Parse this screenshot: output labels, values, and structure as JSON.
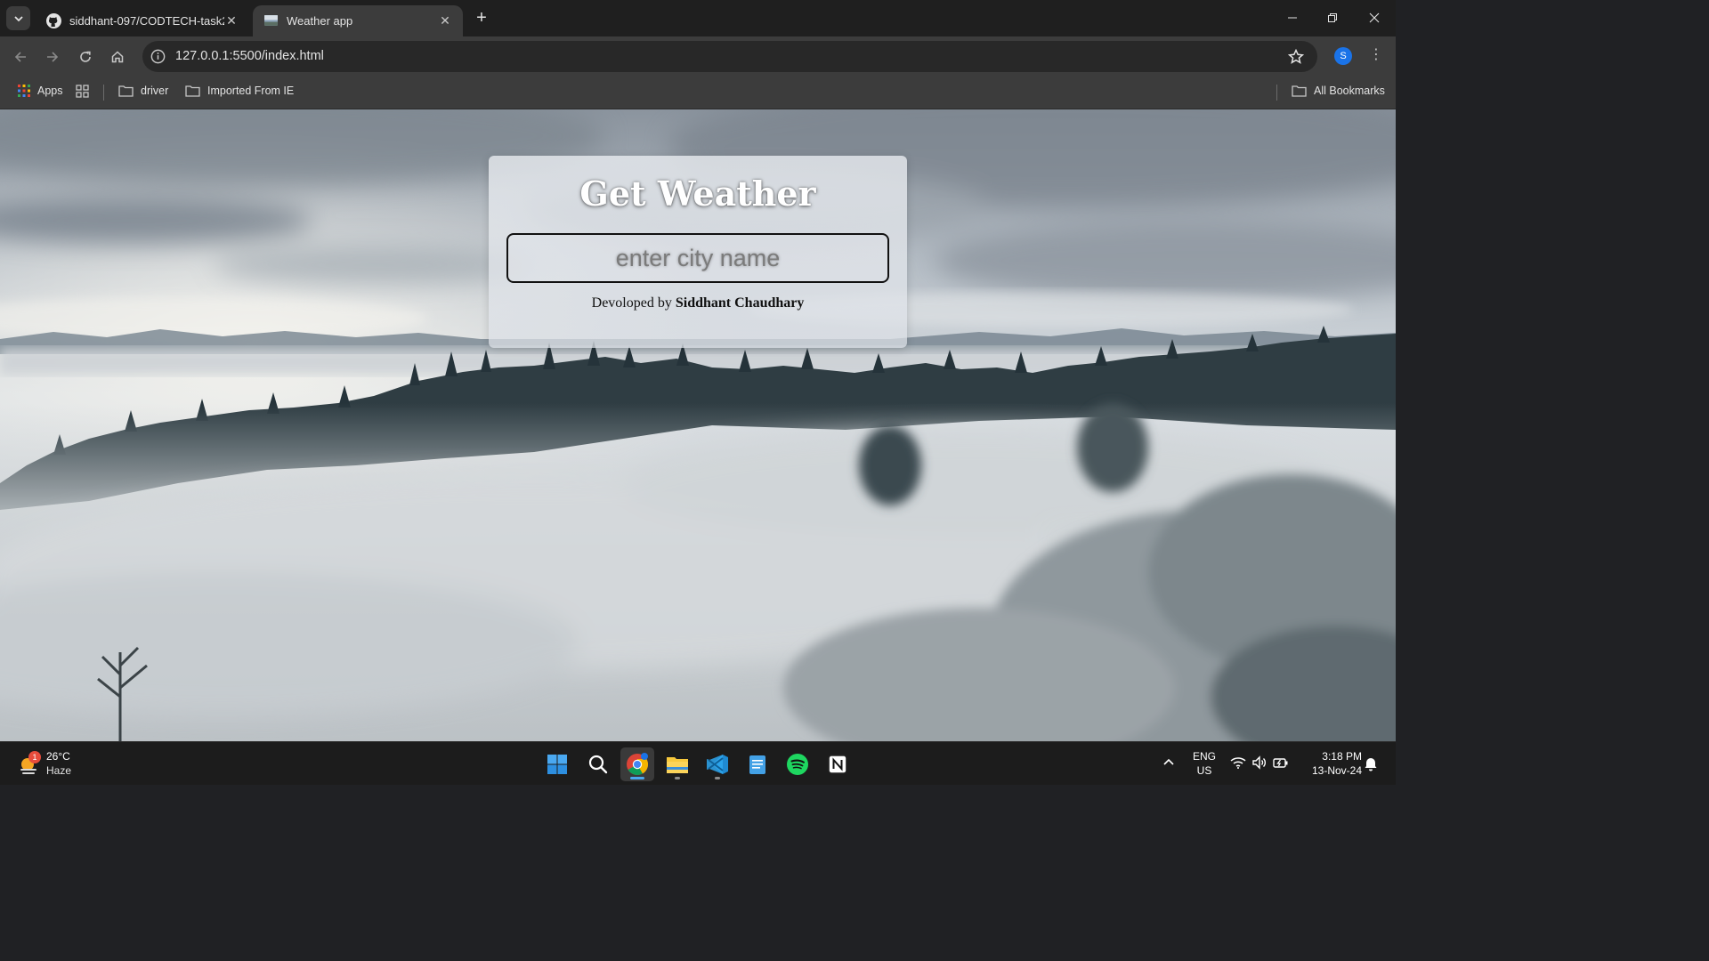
{
  "browser": {
    "tabs": [
      {
        "title": "siddhant-097/CODTECH-task2",
        "active": false,
        "icon": "github-icon"
      },
      {
        "title": "Weather app",
        "active": true,
        "icon": "weather-favicon-icon"
      }
    ],
    "url": "127.0.0.1:5500/index.html",
    "profile_initial": "S",
    "bookmarks": [
      {
        "label": "Apps",
        "icon": "apps-grid-icon"
      },
      {
        "label": "driver",
        "icon": "folder-icon"
      },
      {
        "label": "Imported From IE",
        "icon": "folder-icon"
      }
    ],
    "all_bookmarks_label": "All Bookmarks"
  },
  "page": {
    "title": "Get Weather",
    "input_placeholder": "enter city name",
    "credit_prefix": "Devoloped by",
    "credit_name": "Siddhant Chaudhary"
  },
  "taskbar": {
    "weather_temp": "26°C",
    "weather_desc": "Haze",
    "weather_badge": "1",
    "lang_primary": "ENG",
    "lang_secondary": "US",
    "time": "3:18 PM",
    "date": "13-Nov-24",
    "apps": [
      "start-icon",
      "search-icon",
      "chrome-icon",
      "file-explorer-icon",
      "vscode-icon",
      "notepad-icon",
      "spotify-icon",
      "notion-icon"
    ]
  },
  "colors": {
    "tabstrip": "#1f1f1f",
    "toolbar": "#3c3c3c",
    "omnibox": "#282828",
    "taskbar": "#1c1c1c",
    "accent": "#1a73e8"
  }
}
